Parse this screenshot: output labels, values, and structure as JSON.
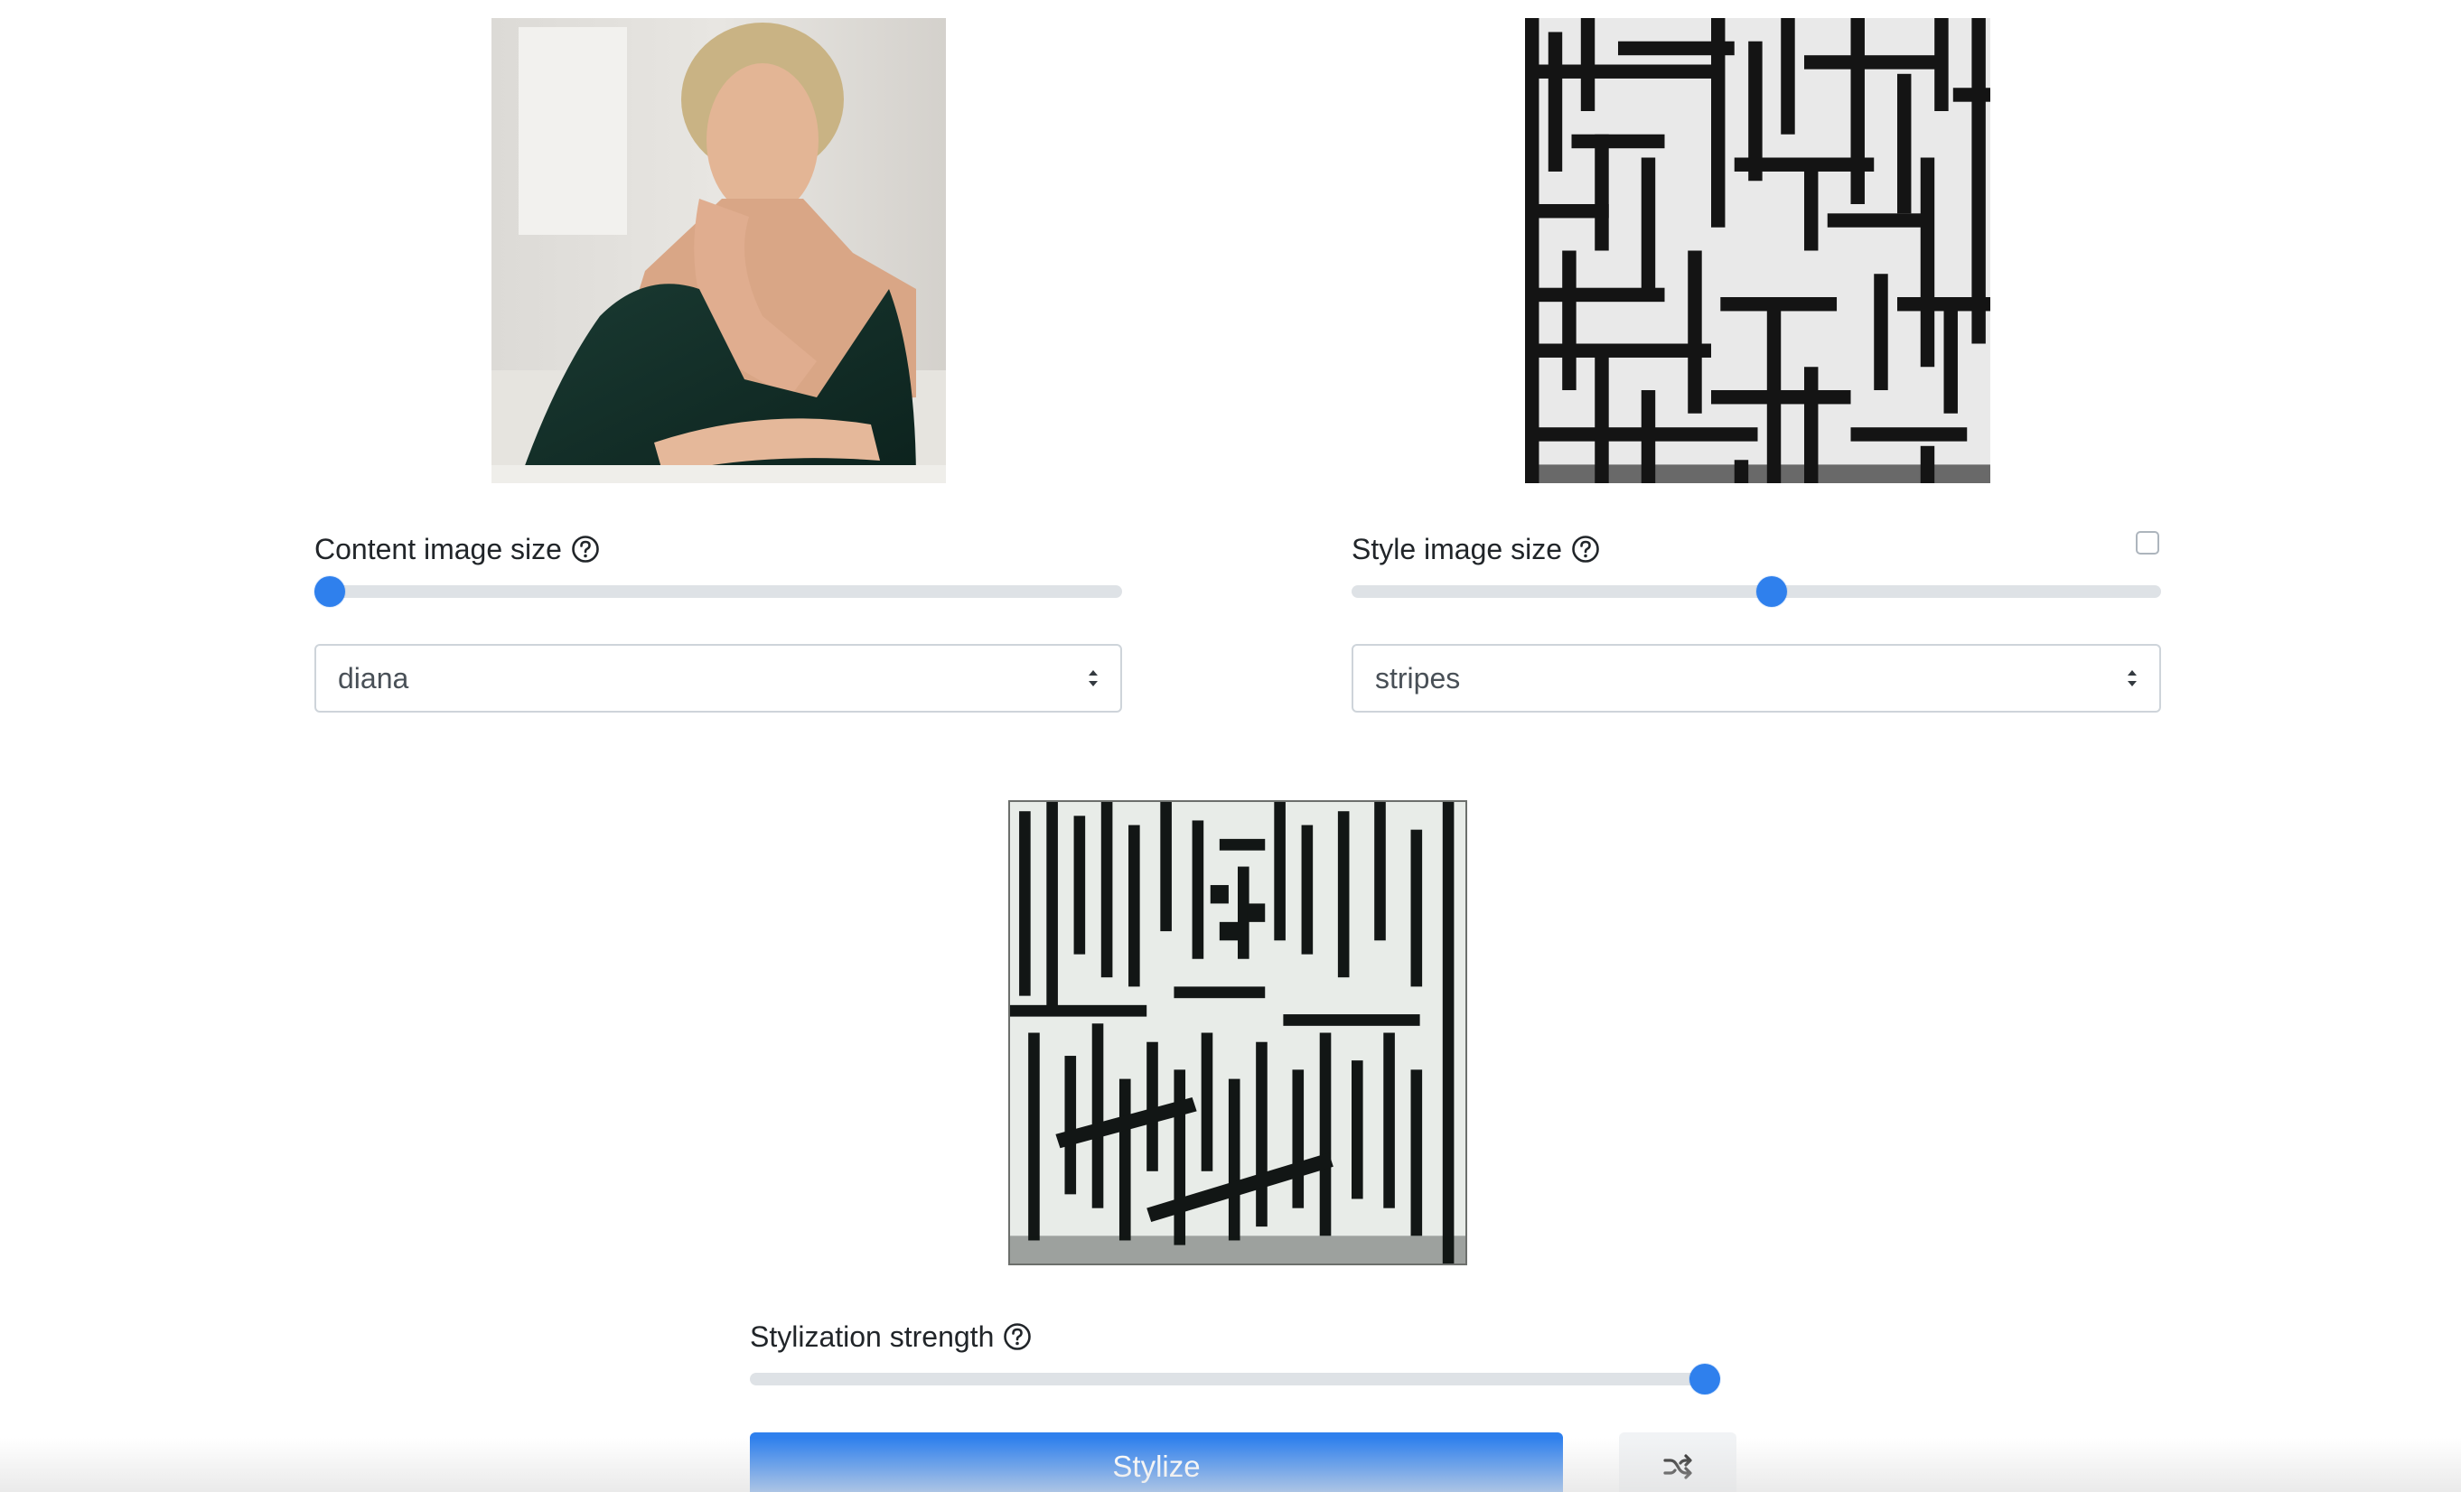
{
  "content": {
    "label": "Content image size",
    "slider_value": 0.0,
    "select_value": "diana",
    "image_name": "content-image"
  },
  "style": {
    "label": "Style image size",
    "slider_value": 0.52,
    "select_value": "stripes",
    "checkbox_checked": false,
    "image_name": "style-image"
  },
  "stylized": {
    "label": "Stylization strength",
    "slider_value": 1.0,
    "image_name": "stylized-result-image"
  },
  "actions": {
    "stylize_label": "Stylize",
    "randomize_icon": "shuffle-icon"
  },
  "icons": {
    "help": "question-circle-icon",
    "select_caret": "sort-caret-icon"
  },
  "colors": {
    "accent": "#2f80ed",
    "track": "#dee2e6",
    "border": "#ced4da",
    "secondary_button": "#f1f3f5"
  }
}
